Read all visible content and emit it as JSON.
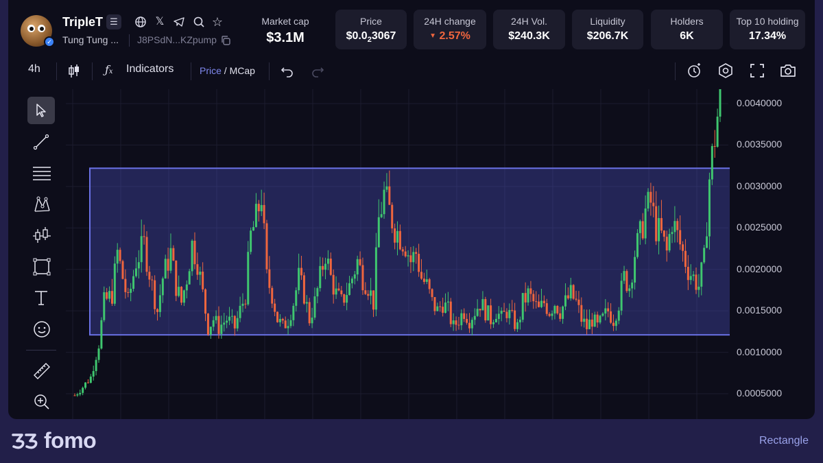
{
  "token": {
    "ticker": "TripleT",
    "name": "Tung Tung ...",
    "address": "J8PSdN...KZpump"
  },
  "stats": {
    "market_cap": {
      "label": "Market cap",
      "value": "$3.1M"
    },
    "price": {
      "label": "Price",
      "prefix": "$0.0",
      "sub": "2",
      "suffix": "3067"
    },
    "change": {
      "label": "24H change",
      "value": "2.57%",
      "color": "#f0663e"
    },
    "volume": {
      "label": "24H Vol.",
      "value": "$240.3K"
    },
    "liquidity": {
      "label": "Liquidity",
      "value": "$206.7K"
    },
    "holders": {
      "label": "Holders",
      "value": "6K"
    },
    "top10": {
      "label": "Top 10 holding",
      "value": "17.34%"
    }
  },
  "toolbar": {
    "interval": "4h",
    "indicators_label": "Indicators",
    "price_label": "Price",
    "divider": " / ",
    "mcap_label": "MCap"
  },
  "icons": {
    "header": [
      "menu-icon",
      "globe-icon",
      "x-icon",
      "telegram-icon",
      "search-icon",
      "star-icon"
    ],
    "toolbar": [
      "candles-icon",
      "function-icon",
      "undo-icon",
      "redo-icon",
      "alert-icon",
      "settings-icon",
      "fullscreen-icon",
      "camera-icon"
    ],
    "tools": [
      "cursor-icon",
      "trendline-icon",
      "horizontal-lines-icon",
      "pattern-icon",
      "candles-tool-icon",
      "rectangle-icon",
      "text-icon",
      "emoji-icon",
      "ruler-icon",
      "zoom-in-icon"
    ]
  },
  "chart_data": {
    "type": "candlestick",
    "y_ticks": [
      "0.0040000",
      "0.0035000",
      "0.0030000",
      "0.0025000",
      "0.0020000",
      "0.0015000",
      "0.0010000",
      "0.0005000"
    ],
    "ylim": [
      0.0004,
      0.0042
    ],
    "grid": true,
    "colors": {
      "up": "#3fc66f",
      "down": "#f0663e",
      "grid": "#1c1c2e",
      "rectangle": "#6a71e6"
    },
    "rectangle_price_range": [
      0.00121,
      0.00322
    ],
    "trace": [
      [
        0,
        0.00048
      ],
      [
        3,
        0.00058
      ],
      [
        6,
        0.0007
      ],
      [
        9,
        0.0011
      ],
      [
        11,
        0.0016
      ],
      [
        14,
        0.0017
      ],
      [
        16,
        0.0022
      ],
      [
        18,
        0.0019
      ],
      [
        20,
        0.0016
      ],
      [
        23,
        0.0021
      ],
      [
        26,
        0.0023
      ],
      [
        29,
        0.0018
      ],
      [
        31,
        0.0015
      ],
      [
        33,
        0.0019
      ],
      [
        36,
        0.0022
      ],
      [
        38,
        0.0018
      ],
      [
        40,
        0.0016
      ],
      [
        42,
        0.0019
      ],
      [
        44,
        0.0023
      ],
      [
        46,
        0.0021
      ],
      [
        48,
        0.0017
      ],
      [
        50,
        0.0013
      ],
      [
        52,
        0.0014
      ],
      [
        54,
        0.0013
      ],
      [
        57,
        0.0014
      ],
      [
        60,
        0.0013
      ],
      [
        62,
        0.0015
      ],
      [
        64,
        0.0017
      ],
      [
        66,
        0.0024
      ],
      [
        68,
        0.0026
      ],
      [
        70,
        0.0029
      ],
      [
        72,
        0.0019
      ],
      [
        74,
        0.0017
      ],
      [
        76,
        0.0014
      ],
      [
        78,
        0.0013
      ],
      [
        80,
        0.0014
      ],
      [
        82,
        0.0016
      ],
      [
        84,
        0.0019
      ],
      [
        86,
        0.0017
      ],
      [
        88,
        0.0014
      ],
      [
        90,
        0.0016
      ],
      [
        92,
        0.0019
      ],
      [
        94,
        0.0022
      ],
      [
        96,
        0.0019
      ],
      [
        98,
        0.0017
      ],
      [
        100,
        0.0016
      ],
      [
        103,
        0.0018
      ],
      [
        106,
        0.0021
      ],
      [
        108,
        0.0019
      ],
      [
        110,
        0.0018
      ],
      [
        112,
        0.0016
      ],
      [
        114,
        0.0026
      ],
      [
        116,
        0.0029
      ],
      [
        118,
        0.0027
      ],
      [
        120,
        0.0025
      ],
      [
        122,
        0.0024
      ],
      [
        124,
        0.0023
      ],
      [
        126,
        0.0021
      ],
      [
        128,
        0.0022
      ],
      [
        130,
        0.0019
      ],
      [
        132,
        0.0018
      ],
      [
        134,
        0.0016
      ],
      [
        136,
        0.0015
      ],
      [
        138,
        0.0016
      ],
      [
        140,
        0.0015
      ],
      [
        142,
        0.0013
      ],
      [
        144,
        0.0014
      ],
      [
        146,
        0.0015
      ],
      [
        148,
        0.0014
      ],
      [
        150,
        0.0015
      ],
      [
        152,
        0.0016
      ],
      [
        154,
        0.0015
      ],
      [
        156,
        0.0014
      ],
      [
        158,
        0.0015
      ],
      [
        160,
        0.0014
      ],
      [
        162,
        0.0015
      ],
      [
        164,
        0.0014
      ],
      [
        166,
        0.0013
      ],
      [
        168,
        0.0016
      ],
      [
        170,
        0.0017
      ],
      [
        172,
        0.0016
      ],
      [
        174,
        0.0015
      ],
      [
        176,
        0.0016
      ],
      [
        178,
        0.0015
      ],
      [
        180,
        0.0016
      ],
      [
        182,
        0.0015
      ],
      [
        184,
        0.0016
      ],
      [
        186,
        0.0017
      ],
      [
        188,
        0.0016
      ],
      [
        190,
        0.0014
      ],
      [
        192,
        0.0013
      ],
      [
        194,
        0.0014
      ],
      [
        196,
        0.0013
      ],
      [
        198,
        0.0014
      ],
      [
        200,
        0.0015
      ],
      [
        202,
        0.0014
      ],
      [
        204,
        0.0016
      ],
      [
        206,
        0.0019
      ],
      [
        208,
        0.0018
      ],
      [
        210,
        0.0022
      ],
      [
        212,
        0.0024
      ],
      [
        214,
        0.0027
      ],
      [
        216,
        0.0028
      ],
      [
        218,
        0.0025
      ],
      [
        220,
        0.0024
      ],
      [
        222,
        0.0022
      ],
      [
        224,
        0.0026
      ],
      [
        226,
        0.0024
      ],
      [
        228,
        0.0022
      ],
      [
        230,
        0.002
      ],
      [
        232,
        0.0019
      ],
      [
        234,
        0.0018
      ],
      [
        236,
        0.0021
      ],
      [
        238,
        0.0031
      ],
      [
        240,
        0.0036
      ],
      [
        242,
        0.0041
      ]
    ],
    "candle_count": 243,
    "seed": 7
  },
  "footer": {
    "brand": "fomo",
    "status": "Rectangle"
  }
}
